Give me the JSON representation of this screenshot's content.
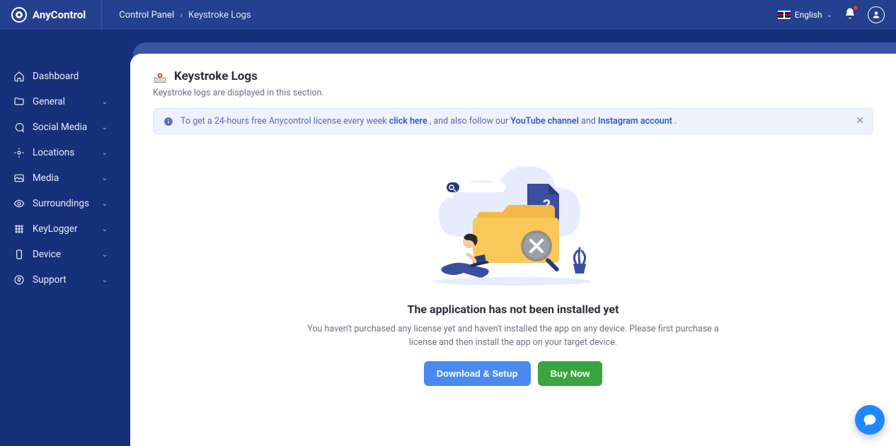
{
  "brand": "AnyControl",
  "breadcrumb": {
    "root": "Control Panel",
    "current": "Keystroke Logs"
  },
  "topbar": {
    "language": "English"
  },
  "sidebar": {
    "items": [
      {
        "label": "Dashboard",
        "chev": false
      },
      {
        "label": "General",
        "chev": true
      },
      {
        "label": "Social Media",
        "chev": true
      },
      {
        "label": "Locations",
        "chev": true
      },
      {
        "label": "Media",
        "chev": true
      },
      {
        "label": "Surroundings",
        "chev": true
      },
      {
        "label": "KeyLogger",
        "chev": true
      },
      {
        "label": "Device",
        "chev": true
      },
      {
        "label": "Support",
        "chev": true
      }
    ]
  },
  "page": {
    "title": "Keystroke Logs",
    "subtitle": "Keystroke logs are displayed in this section."
  },
  "banner": {
    "t1": "To get a 24-hours free Anycontrol license every week ",
    "link1": "click here",
    "t2": " , and also follow our ",
    "link2": "YouTube channel",
    "t3": " and ",
    "link3": "Instagram account",
    "t4": " ."
  },
  "empty": {
    "title": "The application has not been installed yet",
    "desc": "You haven't purchased any license yet and haven't installed the app on any device. Please first purchase a license and then install the app on your target device.",
    "btn_download": "Download & Setup",
    "btn_buy": "Buy Now"
  }
}
